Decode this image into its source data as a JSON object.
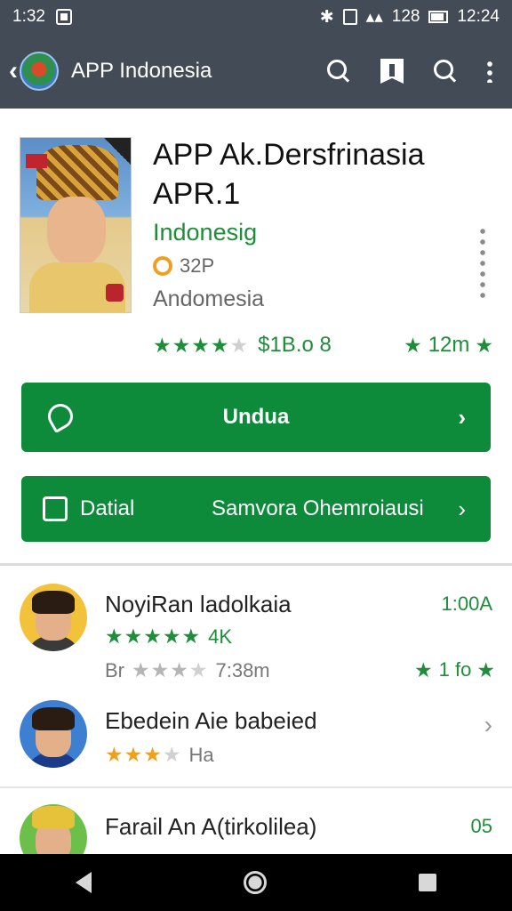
{
  "status_bar": {
    "time_left": "1:32",
    "indicator": "128",
    "time_right": "12:24"
  },
  "toolbar": {
    "title": "APP Indonesia",
    "icons": [
      "back-icon",
      "app-logo",
      "search-icon",
      "bookmark-icon",
      "search-icon",
      "more-vert-icon"
    ]
  },
  "app": {
    "title_line1": "APP Ak.Dersfrinasia",
    "title_line2": "APR.1",
    "developer": "Indonesig",
    "age": "32P",
    "region": "Andomesia",
    "rating_stars": "★★★★",
    "rating_stars_off": "★",
    "rating_count": "$1B.o 8",
    "downloads": "12m"
  },
  "buttons": {
    "install": "Undua",
    "detail": "Datial",
    "share": "Samvora Ohemroiausi"
  },
  "list": [
    {
      "name": "NoyiRan ladolkaia",
      "right": "1:00A",
      "stars": "★★★★★",
      "stars_off": "",
      "count": "4K",
      "sub": "Br",
      "sub_stars": "★★★",
      "sub_stars_off": "★",
      "sub_time": "7:38m",
      "sub_right": "1 fo"
    },
    {
      "name": "Ebedein Aie babeied",
      "stars": "★★★",
      "stars_off": "★",
      "count": "Ha"
    },
    {
      "name": "Farail An A(tirkolilea)",
      "right": "05"
    }
  ],
  "colors": {
    "toolbar": "#434c56",
    "accent_green": "#0d8a3a",
    "text_green": "#1f8d3a",
    "star_orange": "#f0a020"
  }
}
